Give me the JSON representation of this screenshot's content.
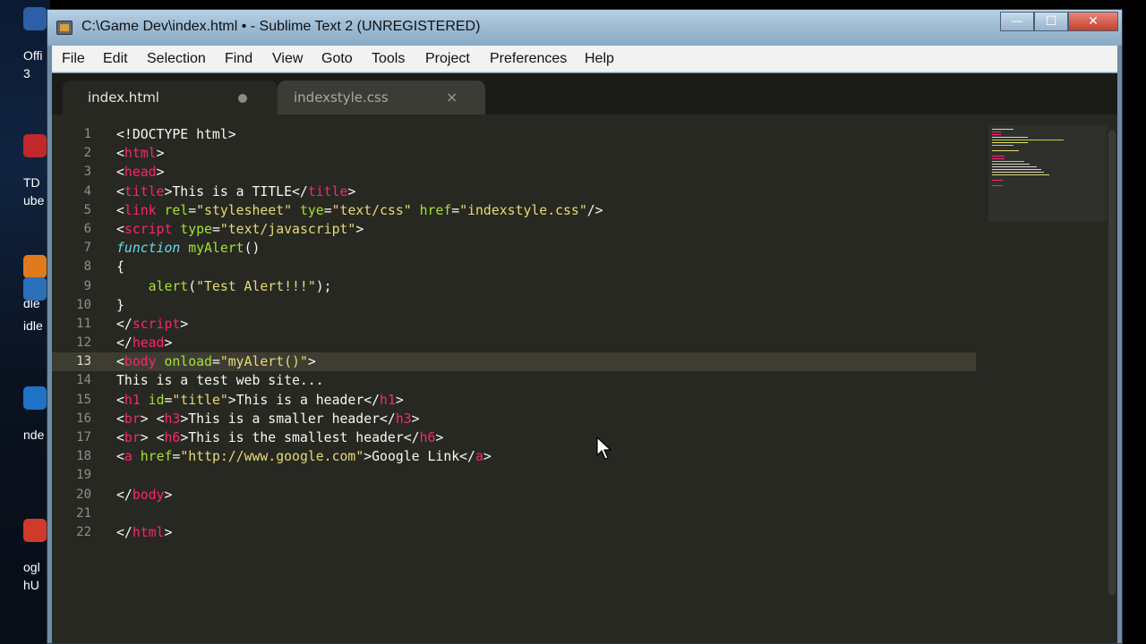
{
  "desktop": {
    "items": [
      {
        "label1": "Offi",
        "label2": "3",
        "color": "#2d5fa8"
      },
      {
        "label1": "TD",
        "label2": "ube",
        "color": "#c0282a"
      },
      {
        "label1": "dle",
        "label2": "",
        "color": "#e07a1c"
      },
      {
        "label1": "idle",
        "label2": "",
        "color": "#2b6fb8"
      },
      {
        "label1": "nde",
        "label2": "",
        "color": "#1f73c6"
      },
      {
        "label1": "ogl",
        "label2": "hU",
        "color": "#d03a2a"
      }
    ]
  },
  "window": {
    "title": "C:\\Game Dev\\index.html • - Sublime Text 2 (UNREGISTERED)",
    "min_glyph": "—",
    "max_glyph": "☐",
    "close_glyph": "✕"
  },
  "menu": [
    "File",
    "Edit",
    "Selection",
    "Find",
    "View",
    "Goto",
    "Tools",
    "Project",
    "Preferences",
    "Help"
  ],
  "tabs": [
    {
      "label": "index.html",
      "active": true,
      "dirty": true
    },
    {
      "label": "indexstyle.css",
      "active": false,
      "close_glyph": "×"
    }
  ],
  "editor": {
    "current_line": 13,
    "colors": {
      "text": "#f8f8f2",
      "tag": "#f92672",
      "attr": "#a6e22e",
      "string": "#e6db74",
      "keyword": "#66d9ef",
      "background": "#272822",
      "gutter": "#8f908a"
    },
    "lines": [
      [
        [
          "<!DOCTYPE html>",
          "t"
        ]
      ],
      [
        [
          "<",
          "t"
        ],
        [
          "html",
          "g"
        ],
        [
          ">",
          "t"
        ]
      ],
      [
        [
          "<",
          "t"
        ],
        [
          "head",
          "g"
        ],
        [
          ">",
          "t"
        ]
      ],
      [
        [
          "<",
          "t"
        ],
        [
          "title",
          "g"
        ],
        [
          ">This is a TITLE</",
          "t"
        ],
        [
          "title",
          "g"
        ],
        [
          ">",
          "t"
        ]
      ],
      [
        [
          "<",
          "t"
        ],
        [
          "link",
          "g"
        ],
        [
          " ",
          "t"
        ],
        [
          "rel",
          "a"
        ],
        [
          "=",
          "t"
        ],
        [
          "\"stylesheet\"",
          "s"
        ],
        [
          " ",
          "t"
        ],
        [
          "tye",
          "a"
        ],
        [
          "=",
          "t"
        ],
        [
          "\"text/css\"",
          "s"
        ],
        [
          " ",
          "t"
        ],
        [
          "href",
          "a"
        ],
        [
          "=",
          "t"
        ],
        [
          "\"indexstyle.css\"",
          "s"
        ],
        [
          "/>",
          "t"
        ]
      ],
      [
        [
          "<",
          "t"
        ],
        [
          "script",
          "g"
        ],
        [
          " ",
          "t"
        ],
        [
          "type",
          "a"
        ],
        [
          "=",
          "t"
        ],
        [
          "\"text/javascript\"",
          "s"
        ],
        [
          ">",
          "t"
        ]
      ],
      [
        [
          "function",
          "k"
        ],
        [
          " ",
          "t"
        ],
        [
          "myAlert",
          "a"
        ],
        [
          "()",
          "t"
        ]
      ],
      [
        [
          "{",
          "t"
        ]
      ],
      [
        [
          "    ",
          "t"
        ],
        [
          "alert",
          "a"
        ],
        [
          "(",
          "t"
        ],
        [
          "\"Test Alert!!!\"",
          "s"
        ],
        [
          ");",
          "t"
        ]
      ],
      [
        [
          "}",
          "t"
        ]
      ],
      [
        [
          "</",
          "t"
        ],
        [
          "script",
          "g"
        ],
        [
          ">",
          "t"
        ]
      ],
      [
        [
          "</",
          "t"
        ],
        [
          "head",
          "g"
        ],
        [
          ">",
          "t"
        ]
      ],
      [
        [
          "<",
          "t"
        ],
        [
          "body",
          "g"
        ],
        [
          " ",
          "t"
        ],
        [
          "onload",
          "a"
        ],
        [
          "=",
          "t"
        ],
        [
          "\"myAlert()\"",
          "s"
        ],
        [
          ">",
          "t"
        ]
      ],
      [
        [
          "This is a test web site...",
          "t"
        ]
      ],
      [
        [
          "<",
          "t"
        ],
        [
          "h1",
          "g"
        ],
        [
          " ",
          "t"
        ],
        [
          "id",
          "a"
        ],
        [
          "=",
          "t"
        ],
        [
          "\"title\"",
          "s"
        ],
        [
          ">This is a header</",
          "t"
        ],
        [
          "h1",
          "g"
        ],
        [
          ">",
          "t"
        ]
      ],
      [
        [
          "<",
          "t"
        ],
        [
          "br",
          "g"
        ],
        [
          "> <",
          "t"
        ],
        [
          "h3",
          "g"
        ],
        [
          ">This is a smaller header</",
          "t"
        ],
        [
          "h3",
          "g"
        ],
        [
          ">",
          "t"
        ]
      ],
      [
        [
          "<",
          "t"
        ],
        [
          "br",
          "g"
        ],
        [
          "> <",
          "t"
        ],
        [
          "h6",
          "g"
        ],
        [
          ">This is the smallest header</",
          "t"
        ],
        [
          "h6",
          "g"
        ],
        [
          ">",
          "t"
        ]
      ],
      [
        [
          "<",
          "t"
        ],
        [
          "a",
          "g"
        ],
        [
          " ",
          "t"
        ],
        [
          "href",
          "a"
        ],
        [
          "=",
          "t"
        ],
        [
          "\"http://www.google.com\"",
          "s"
        ],
        [
          ">Google Link</",
          "t"
        ],
        [
          "a",
          "g"
        ],
        [
          ">",
          "t"
        ]
      ],
      [],
      [
        [
          "</",
          "t"
        ],
        [
          "body",
          "g"
        ],
        [
          ">",
          "t"
        ]
      ],
      [],
      [
        [
          "</",
          "t"
        ],
        [
          "html",
          "g"
        ],
        [
          ">",
          "t"
        ]
      ]
    ]
  }
}
